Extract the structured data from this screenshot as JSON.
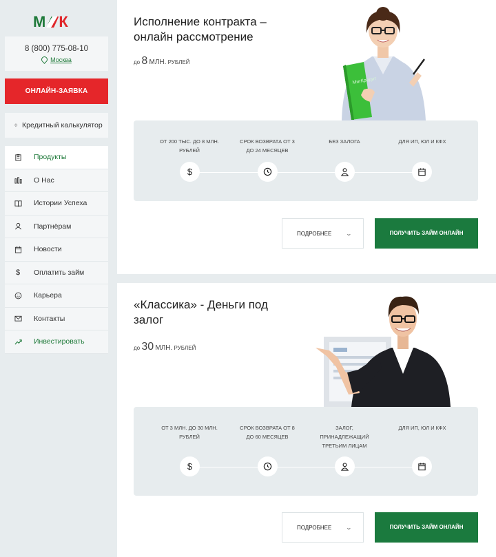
{
  "logo": {
    "left": "М",
    "right": "К"
  },
  "contact": {
    "phone": "8 (800) 775-08-10",
    "city": "Москва"
  },
  "apply_label": "ОНЛАЙН-ЗАЯВКА",
  "calculator_label": "Кредитный калькулятор",
  "nav": [
    {
      "label": "Продукты",
      "icon": "clipboard-icon",
      "active": true
    },
    {
      "label": "О Нас",
      "icon": "bars-icon"
    },
    {
      "label": "Истории Успеха",
      "icon": "book-icon"
    },
    {
      "label": "Партнёрам",
      "icon": "user-icon"
    },
    {
      "label": "Новости",
      "icon": "calendar-icon"
    },
    {
      "label": "Оплатить займ",
      "icon": "dollar-icon"
    },
    {
      "label": "Карьера",
      "icon": "smile-icon"
    },
    {
      "label": "Контакты",
      "icon": "mail-icon"
    },
    {
      "label": "Инвестировать",
      "icon": "trend-icon"
    }
  ],
  "cards": [
    {
      "title": "Исполнение контракта – онлайн рассмотрение",
      "amount_prefix": "до",
      "amount": "8",
      "amount_unit": "МЛН.",
      "amount_suffix": "РУБЛЕЙ",
      "features": [
        {
          "text": "ОТ 200 ТЫС. ДО 8 МЛН. РУБЛЕЙ",
          "icon": "dollar-icon"
        },
        {
          "text": "СРОК ВОЗВРАТА ОТ 3 ДО 24 МЕСЯЦЕВ",
          "icon": "clock-icon"
        },
        {
          "text": "БЕЗ ЗАЛОГА",
          "icon": "user-icon"
        },
        {
          "text": "ДЛЯ ИП, ЮЛ И КФХ",
          "icon": "calendar-icon"
        }
      ],
      "more_label": "ПОДРОБНЕЕ",
      "get_label": "ПОЛУЧИТЬ ЗАЙМ ОНЛАЙН"
    },
    {
      "title": "«Классика» - Деньги под залог",
      "amount_prefix": "до",
      "amount": "30",
      "amount_unit": "МЛН.",
      "amount_suffix": "РУБЛЕЙ",
      "features": [
        {
          "text": "ОТ 3 МЛН. ДО 30 МЛН. РУБЛЕЙ",
          "icon": "dollar-icon"
        },
        {
          "text": "СРОК ВОЗВРАТА ОТ 8 ДО 60 МЕСЯЦЕВ",
          "icon": "clock-icon"
        },
        {
          "text": "ЗАЛОГ, ПРИНАДЛЕЖАЩИЙ ТРЕТЬИМ ЛИЦАМ",
          "icon": "user-icon"
        },
        {
          "text": "ДЛЯ ИП, ЮЛ И КФХ",
          "icon": "calendar-icon"
        }
      ],
      "more_label": "ПОДРОБНЕЕ",
      "get_label": "ПОЛУЧИТЬ ЗАЙМ ОНЛАЙН"
    }
  ],
  "colors": {
    "brand_green": "#1b7a3e",
    "brand_red": "#e5262a",
    "bg": "#e7ecee"
  }
}
